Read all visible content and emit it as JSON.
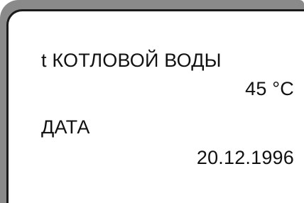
{
  "display": {
    "line1": "t КОТЛОВОЙ ВОДЫ",
    "line2": "45 °C",
    "line3": "ДАТА",
    "line4": "20.12.1996"
  },
  "colors": {
    "frame": "#8a8a8a",
    "border": "#1a1a1a",
    "text": "#111111",
    "background": "#ffffff"
  }
}
